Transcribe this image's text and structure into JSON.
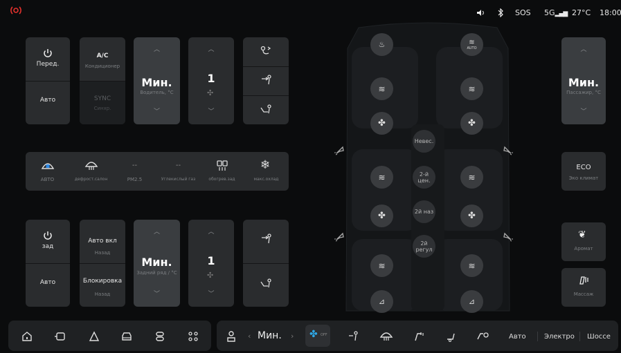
{
  "status_bar": {
    "volume_icon": "volume-icon",
    "bluetooth_icon": "bluetooth-icon",
    "sos": "SOS",
    "network": "5G",
    "temperature": "27°C",
    "time": "18:00",
    "alert_color": "#e5322d"
  },
  "front_panel": {
    "power_label": "Перед.",
    "auto_label": "Авто",
    "ac_label": "A/C",
    "ac_sub": "Кондиционер",
    "sync_label": "SYNC",
    "sync_sub": "Синхр.",
    "driver_temp": "Мин.",
    "driver_temp_sub": "Водитель, °C",
    "fan_level": "1"
  },
  "function_row": {
    "items": [
      {
        "label": "АВТО",
        "icon": "auto-windshield-icon"
      },
      {
        "label": "дефрост.салон",
        "icon": "defrost-front-icon"
      },
      {
        "label": "PM2.5",
        "value": "--"
      },
      {
        "label": "Углекислый газ",
        "value": "--"
      },
      {
        "label": "обогрев.зад",
        "icon": "rear-defrost-icon"
      },
      {
        "label": "макс.охлад",
        "icon": "snowflake-icon"
      }
    ]
  },
  "rear_panel": {
    "power_label": "зад",
    "auto_label": "Авто",
    "auto_on_label": "Авто вкл",
    "auto_on_sub": "Назад",
    "lock_label": "Блокировка",
    "lock_sub": "Назад",
    "temp": "Мин.",
    "temp_sub": "Задний ряд / °C",
    "fan_level": "1"
  },
  "seat_map": {
    "nevesomost": "Невес.",
    "row2_center": "2-й цен.",
    "row2_back": "2й наз",
    "row2_adjust": "2й регул",
    "auto_badge": "AUTO"
  },
  "right_panel": {
    "passenger_temp": "Мин.",
    "passenger_temp_sub": "Пассажир, °C",
    "eco_label": "ECO",
    "eco_sub": "Эко климат",
    "aroma_sub": "Аромат",
    "massage_sub": "Массаж"
  },
  "bottom_bar": {
    "temp_value": "Мин.",
    "fan_off": "OFF",
    "modes": [
      "Авто",
      "Электро",
      "Шоссе"
    ]
  }
}
